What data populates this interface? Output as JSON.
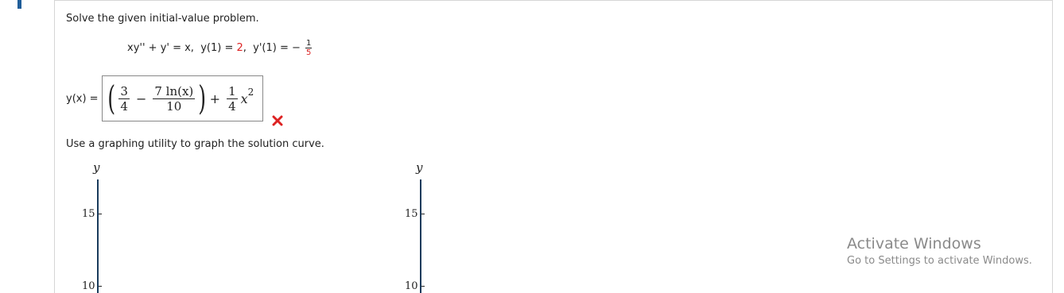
{
  "problem": {
    "prompt": "Solve the given initial-value problem.",
    "ode_lhs": "xy'' + y' = x,  y(1) = ",
    "ic1_value": "2",
    "ic2_prefix": ",  y'(1) = − ",
    "ic2_num": "1",
    "ic2_den": "5"
  },
  "answer": {
    "label": "y(x) =",
    "term1_num": "3",
    "term1_den": "4",
    "minus": "−",
    "term2_num": "7 ln(x)",
    "term2_den": "10",
    "plus": "+",
    "term3_num": "1",
    "term3_den": "4",
    "var": "x",
    "exp": "2",
    "status_icon": "red-x-icon",
    "status": "incorrect"
  },
  "graph": {
    "prompt": "Use a graphing utility to graph the solution curve.",
    "left_plot": {
      "y_label": "y",
      "tick_15": "15",
      "tick_10": "10"
    },
    "right_plot": {
      "y_label": "y",
      "tick_15": "15",
      "tick_10": "10"
    }
  },
  "watermark": {
    "title": "Activate Windows",
    "subtitle": "Go to Settings to activate Windows."
  },
  "colors": {
    "accent": "#1f5d99",
    "error": "#dd2222"
  }
}
